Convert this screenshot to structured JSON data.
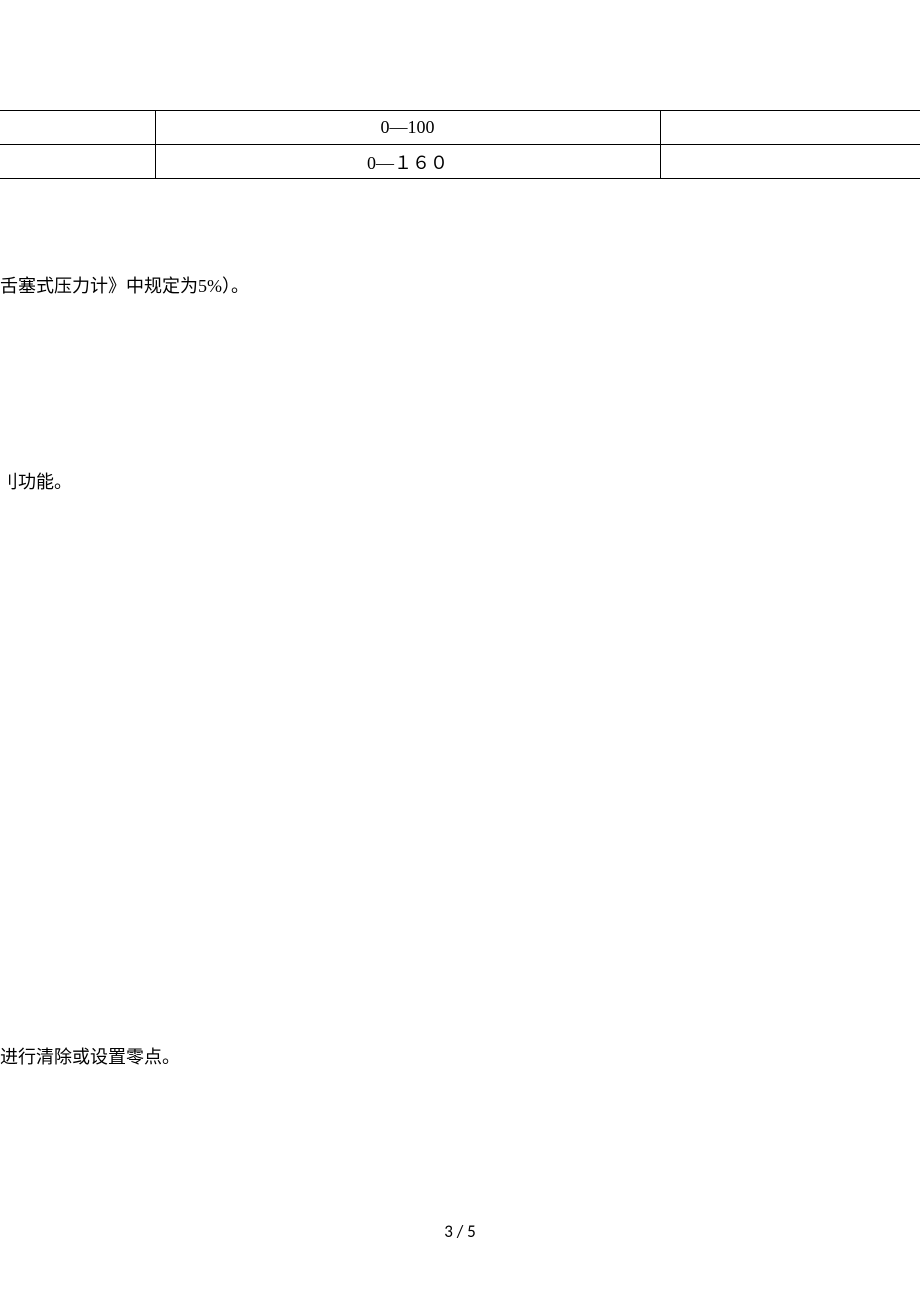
{
  "table": {
    "rows": [
      {
        "a": "",
        "b": "0—100",
        "c": ""
      },
      {
        "a": "",
        "b": "0—１６０",
        "c": ""
      }
    ]
  },
  "paragraphs": {
    "p1": "舌塞式压力计》中规定为5%）。",
    "p2": "刂功能。",
    "p3": "进行清除或设置零点。"
  },
  "pagination": {
    "label": "3 / 5"
  }
}
